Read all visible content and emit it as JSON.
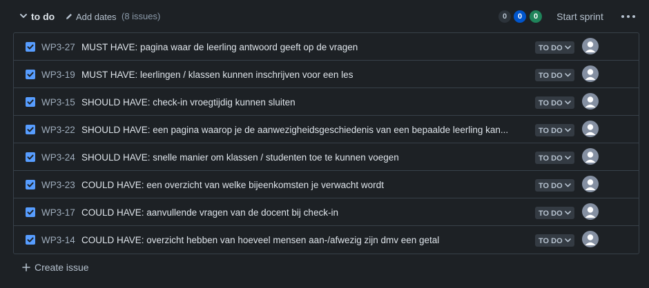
{
  "sprint": {
    "name": "to do",
    "add_dates": "Add dates",
    "issue_count": "(8 issues)",
    "counts": {
      "todo": "0",
      "in_progress": "0",
      "done": "0"
    },
    "start_sprint": "Start sprint"
  },
  "issues": [
    {
      "key": "WP3-27",
      "summary": "MUST HAVE: pagina waar de leerling antwoord geeft op de vragen",
      "status": "TO DO",
      "checked": true
    },
    {
      "key": "WP3-19",
      "summary": "MUST HAVE: leerlingen / klassen kunnen inschrijven voor een les",
      "status": "TO DO",
      "checked": true
    },
    {
      "key": "WP3-15",
      "summary": "SHOULD HAVE: check-in vroegtijdig kunnen sluiten",
      "status": "TO DO",
      "checked": true
    },
    {
      "key": "WP3-22",
      "summary": "SHOULD HAVE: een pagina waarop je de aanwezigheidsgeschiedenis van een bepaalde leerling kan...",
      "status": "TO DO",
      "checked": true
    },
    {
      "key": "WP3-24",
      "summary": "SHOULD HAVE: snelle manier om klassen / studenten toe te kunnen voegen",
      "status": "TO DO",
      "checked": true
    },
    {
      "key": "WP3-23",
      "summary": "COULD HAVE: een overzicht van welke bijeenkomsten je verwacht wordt",
      "status": "TO DO",
      "checked": true
    },
    {
      "key": "WP3-17",
      "summary": "COULD HAVE: aanvullende vragen van de docent bij check-in",
      "status": "TO DO",
      "checked": true
    },
    {
      "key": "WP3-14",
      "summary": "COULD HAVE: overzicht hebben van hoeveel mensen aan-/afwezig zijn dmv een getal",
      "status": "TO DO",
      "checked": true
    }
  ],
  "create_issue": "Create issue",
  "colors": {
    "background": "#1d2125",
    "checkbox": "#579dff",
    "pill_blue": "#0055cc",
    "pill_green": "#1f845a"
  },
  "icons": [
    "chevron-down-icon",
    "pencil-icon",
    "checkbox-checked-icon",
    "chevron-down-icon",
    "avatar-icon",
    "more-icon",
    "plus-icon"
  ]
}
